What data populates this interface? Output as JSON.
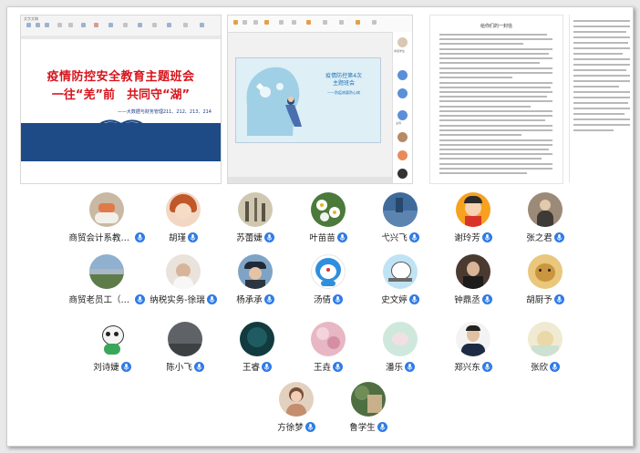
{
  "shared_screens": {
    "doc": {
      "window_title": "文字文稿",
      "title_line1": "疫情防控安全教育主题班会",
      "title_line2": "一往“羌”前　共同守“湖”",
      "subtitle": "——大数据与财务管理211、212、213、214"
    },
    "slide": {
      "title_line1": "疫情防控第4次",
      "title_line2": "主题班会",
      "subtitle": "——防疫病要防心病",
      "side_label_1": "商贸学生",
      "side_label_2": "主持"
    },
    "letter": {
      "title": "给你们的一封信"
    }
  },
  "participants": [
    {
      "name": "商贸会计系教学...",
      "avatar": "avatar-photo-cake"
    },
    {
      "name": "胡瑾",
      "avatar": "avatar-cartoon-girl"
    },
    {
      "name": "苏蕾婕",
      "avatar": "avatar-ink-painting"
    },
    {
      "name": "叶苗苗",
      "avatar": "avatar-daisies"
    },
    {
      "name": "弋兴飞",
      "avatar": "avatar-blue-painting"
    },
    {
      "name": "谢玲芳",
      "avatar": "avatar-cartoon-boy-orange"
    },
    {
      "name": "张之君",
      "avatar": "avatar-photo-person"
    },
    {
      "name": "商贸老员工（光...",
      "avatar": "avatar-landscape"
    },
    {
      "name": "纳税实务-徐瑞",
      "avatar": "avatar-baby-photo"
    },
    {
      "name": "杨承承",
      "avatar": "avatar-photo-hat"
    },
    {
      "name": "汤倩",
      "avatar": "avatar-doraemon"
    },
    {
      "name": "史文婷",
      "avatar": "avatar-cartoon-cat-text"
    },
    {
      "name": "钟鼎丞",
      "avatar": "avatar-photo-man"
    },
    {
      "name": "胡厨予",
      "avatar": "avatar-cat-photo"
    },
    {
      "name": "刘诗婕",
      "avatar": "avatar-panda-mascot"
    },
    {
      "name": "陈小飞",
      "avatar": "avatar-dark-gray"
    },
    {
      "name": "王睿",
      "avatar": "avatar-dark-teal"
    },
    {
      "name": "王垚",
      "avatar": "avatar-pink-flowers"
    },
    {
      "name": "潘乐",
      "avatar": "avatar-pastel-drawing"
    },
    {
      "name": "郑兴东",
      "avatar": "avatar-man-suit"
    },
    {
      "name": "张欣",
      "avatar": "avatar-cartoon-pastel"
    },
    {
      "name": "方徐梦",
      "avatar": "avatar-girl-portrait"
    },
    {
      "name": "鲁学生",
      "avatar": "avatar-plant-photo"
    }
  ],
  "colors": {
    "mic_blue": "#2f7be6",
    "title_red": "#d7141c",
    "band_navy": "#1e4a86"
  }
}
